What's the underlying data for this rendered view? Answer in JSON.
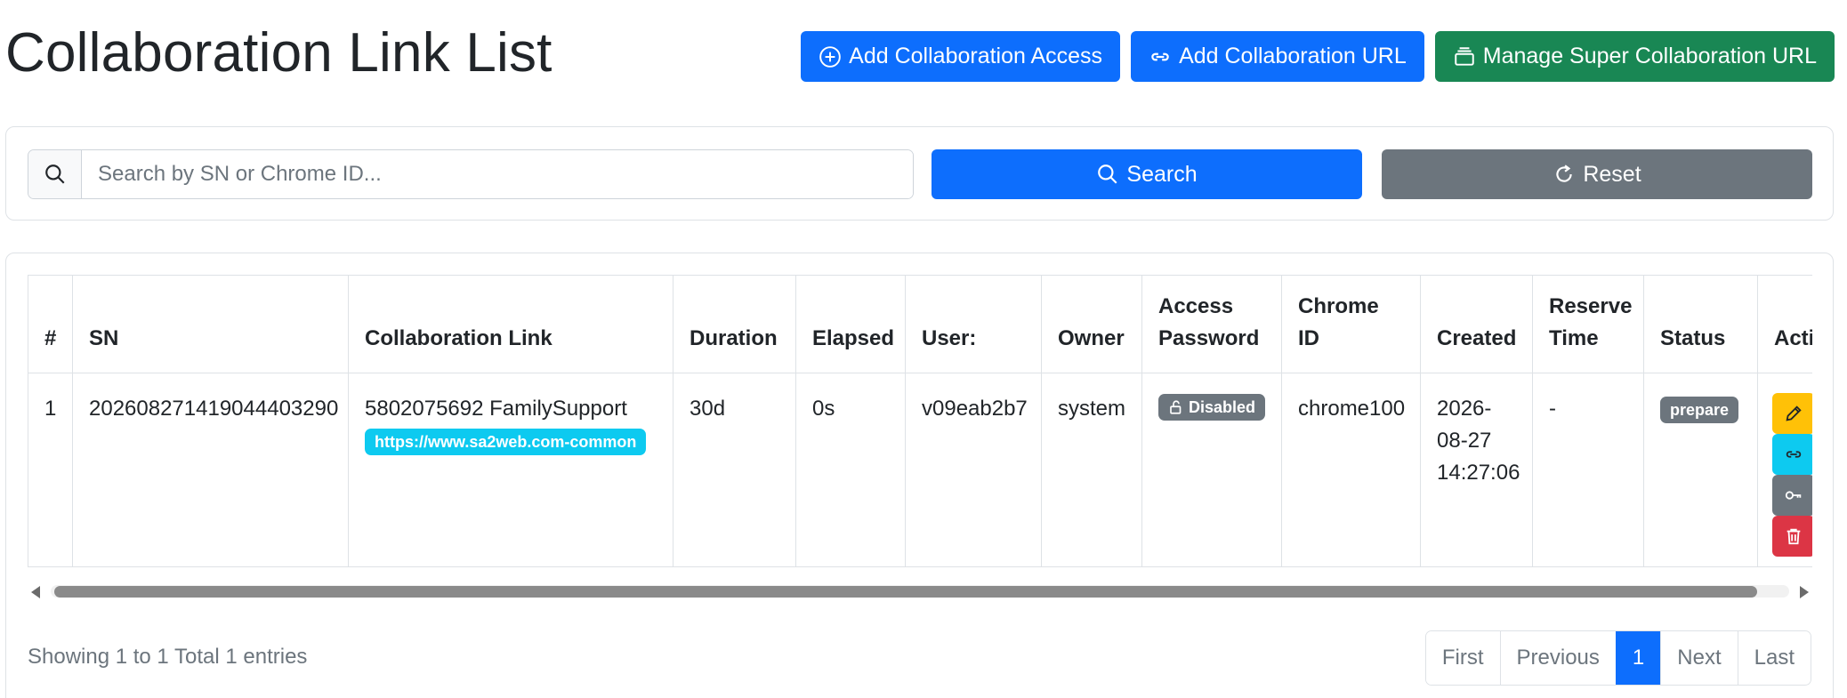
{
  "page": {
    "title": "Collaboration Link List"
  },
  "header_actions": {
    "add_access": "Add Collaboration Access",
    "add_url": "Add Collaboration URL",
    "manage_super": "Manage Super Collaboration URL"
  },
  "search": {
    "placeholder": "Search by SN or Chrome ID...",
    "value": "",
    "search_label": "Search",
    "reset_label": "Reset"
  },
  "table": {
    "columns": [
      "#",
      "SN",
      "Collaboration Link",
      "Duration",
      "Elapsed",
      "User:",
      "Owner",
      "Access Password",
      "Chrome ID",
      "Created",
      "Reserve Time",
      "Status",
      "Actio"
    ],
    "rows": [
      {
        "index": "1",
        "sn": "20260827141904440329 0",
        "sn_full": "202608271419044403290",
        "link_name": "5802075692 FamilySupport",
        "link_url": "https://www.sa2web.com-common",
        "duration": "30d",
        "elapsed": "0s",
        "user": "v09eab2b7",
        "owner": "system",
        "access_password": "Disabled",
        "chrome_id": "chrome100",
        "created": "2026-08-27 14:27:06",
        "reserve_time": "-",
        "status": "prepare"
      }
    ]
  },
  "footer": {
    "entries_info": "Showing 1 to 1 Total 1 entries",
    "pagination": {
      "first": "First",
      "previous": "Previous",
      "current": "1",
      "next": "Next",
      "last": "Last"
    }
  },
  "colors": {
    "primary": "#0d6efd",
    "success": "#198754",
    "secondary": "#6c757d",
    "info": "#0dcaf0",
    "warning": "#ffc107",
    "danger": "#dc3545"
  },
  "icons": {
    "add_access": "plus-circle-icon",
    "add_url": "link-icon",
    "manage_super": "collection-icon",
    "search": "search-icon",
    "reset": "refresh-icon",
    "disabled": "unlock-icon",
    "edit": "pencil-icon",
    "link": "link-icon",
    "key": "key-icon",
    "delete": "trash-icon"
  }
}
